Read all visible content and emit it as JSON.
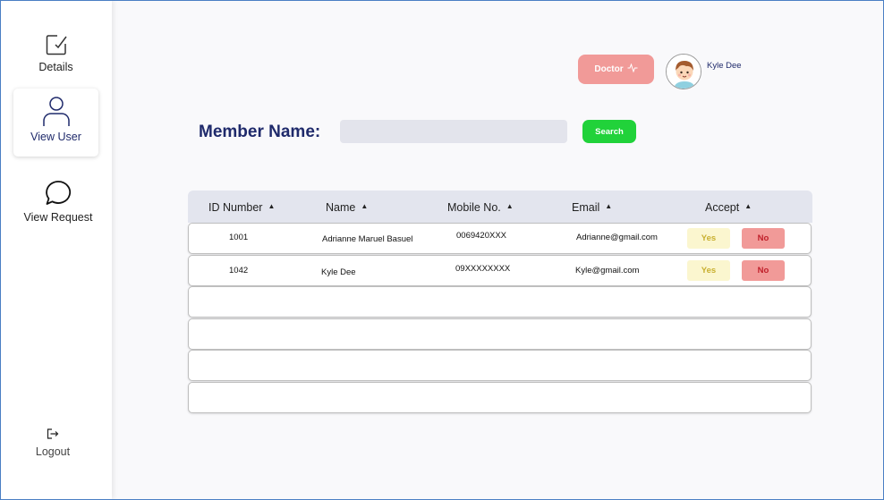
{
  "sidebar": {
    "details": "Details",
    "view_user": "View User",
    "view_request": "View Request",
    "logout": "Logout"
  },
  "header": {
    "doctor_label": "Doctor",
    "user_name": "Kyle Dee"
  },
  "search": {
    "label": "Member Name:",
    "value": "",
    "placeholder": "",
    "button": "Search"
  },
  "table": {
    "columns": [
      "ID Number",
      "Name",
      "Mobile No.",
      "Email",
      "Accept"
    ],
    "rows": [
      {
        "id": "1001",
        "name": "Adrianne Maruel Basuel",
        "mobile": "0069420XXX",
        "email": "Adrianne@gmail.com",
        "yes": "Yes",
        "no": "No"
      },
      {
        "id": "1042",
        "name": "Kyle Dee",
        "mobile": "09XXXXXXXX",
        "email": "Kyle@gmail.com",
        "yes": "Yes",
        "no": "No"
      }
    ]
  },
  "colors": {
    "accent": "#1f2a6b",
    "doctor": "#f19a98",
    "search": "#21d23a",
    "yes_bg": "#fbf6cf",
    "no_bg": "#f19a98"
  }
}
